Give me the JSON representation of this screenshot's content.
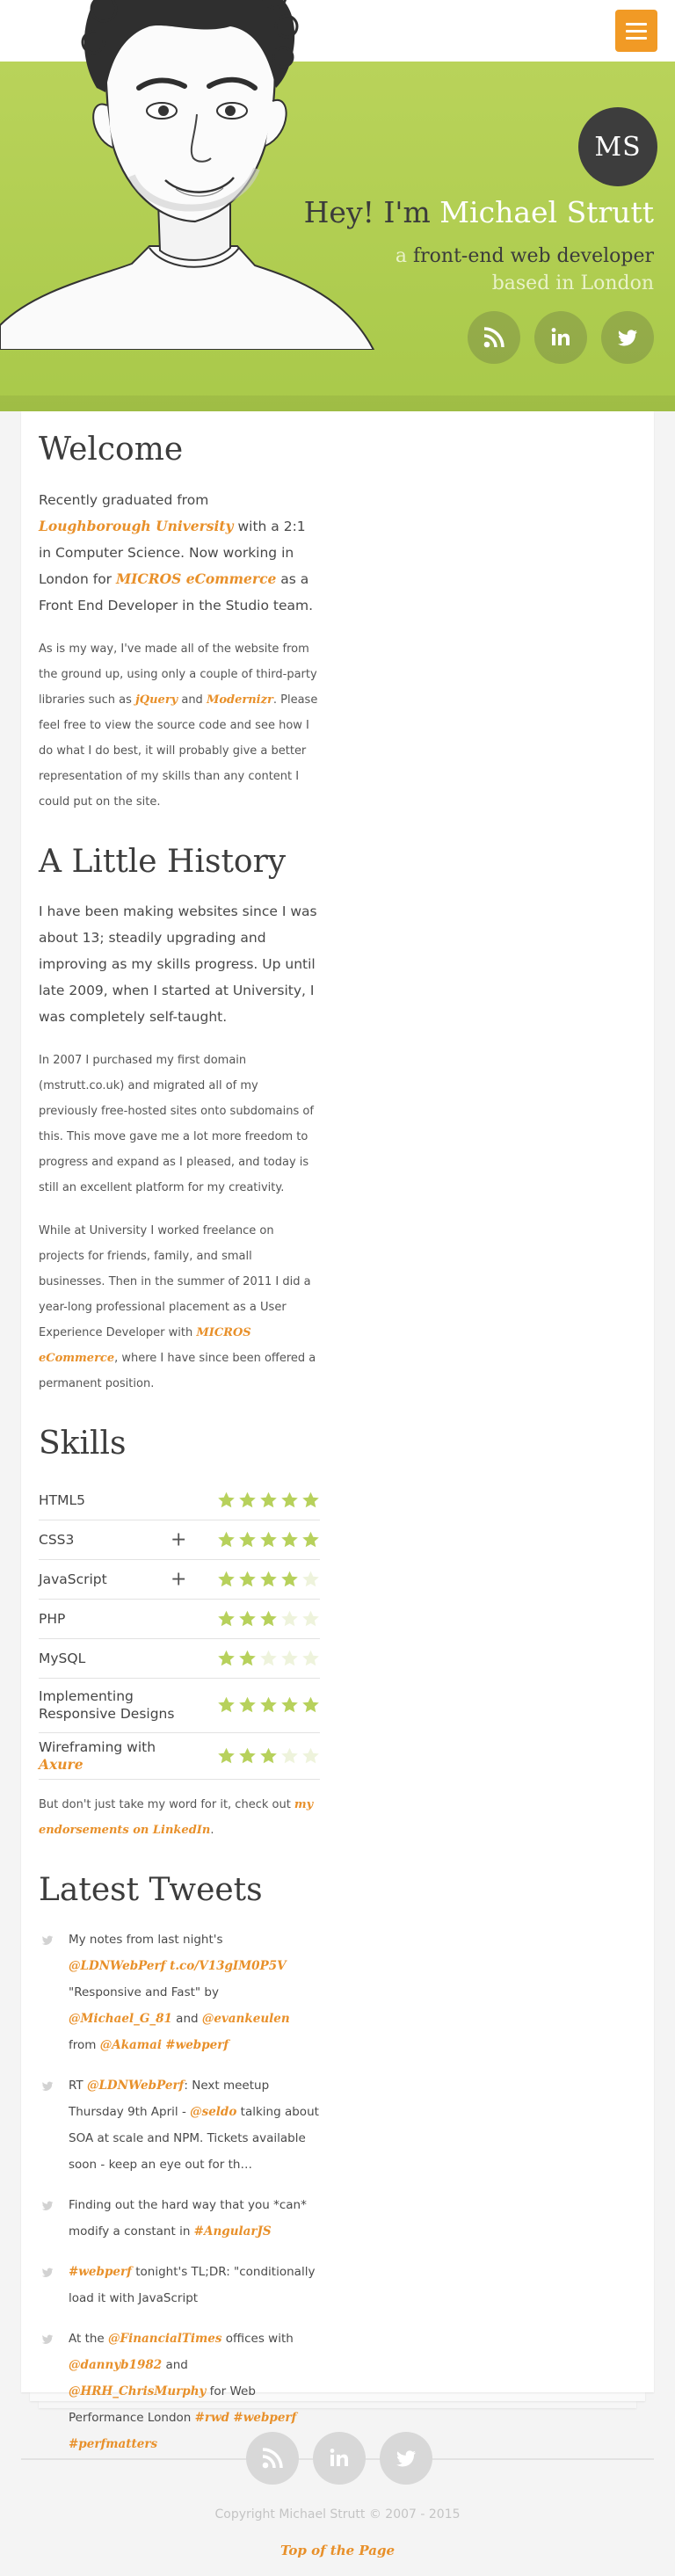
{
  "colors": {
    "accent": "#e8902a",
    "hero_green": "#b5cf54",
    "dark": "#3c3c3c",
    "star_on": "#b7d15c",
    "star_off": "#eef3dc"
  },
  "header": {
    "menu_icon": "hamburger-icon"
  },
  "hero": {
    "monogram": "MS",
    "greeting": "Hey! I'm ",
    "name": "Michael Strutt",
    "sub_a": "a ",
    "sub_role": "front-end web developer",
    "sub_b": " based in London",
    "social": [
      {
        "name": "rss",
        "icon": "rss-icon"
      },
      {
        "name": "linkedin",
        "icon": "linkedin-icon"
      },
      {
        "name": "twitter",
        "icon": "twitter-icon"
      }
    ]
  },
  "welcome": {
    "heading": "Welcome",
    "p1_a": "Recently graduated from ",
    "p1_link1": "Loughborough University",
    "p1_b": " with a 2:1 in Computer Science. Now working in London for ",
    "p1_link2": "MICROS eCommerce",
    "p1_c": " as a Front End Developer in the Studio team.",
    "p2_a": "As is my way, I've made all of the website from the ground up, using only a couple of third-party libraries such as ",
    "p2_link1": "jQuery",
    "p2_b": " and ",
    "p2_link2": "Modernizr",
    "p2_c": ". Please feel free to view the source code and see how I do what I do best, it will probably give a better representation of my skills than any content I could put on the site."
  },
  "history": {
    "heading": "A Little History",
    "p1": "I have been making websites since I was about 13; steadily upgrading and improving as my skills progress. Up until late 2009, when I started at University, I was completely self-taught.",
    "p2": "In 2007 I purchased my first domain (mstrutt.co.uk) and migrated all of my previously free-hosted sites onto subdomains of this. This move gave me a lot more freedom to progress and expand as I pleased, and today is still an excellent platform for my creativity.",
    "p3_a": "While at University I worked freelance on projects for friends, family, and small businesses. Then in the summer of 2011 I did a year-long professional placement as a User Experience Developer with ",
    "p3_link": "MICROS eCommerce",
    "p3_b": ", where I have since been offered a permanent position."
  },
  "skills": {
    "heading": "Skills",
    "items": [
      {
        "name": "HTML5",
        "rating": 5,
        "expandable": false
      },
      {
        "name": "CSS3",
        "rating": 5,
        "expandable": true
      },
      {
        "name": "JavaScript",
        "rating": 4,
        "expandable": true
      },
      {
        "name": "PHP",
        "rating": 3,
        "expandable": false
      },
      {
        "name": "MySQL",
        "rating": 2,
        "expandable": false
      },
      {
        "name": "Implementing Responsive Designs",
        "rating": 5,
        "expandable": false
      },
      {
        "name": "Wireframing with ",
        "link": "Axure",
        "rating": 3,
        "expandable": false
      }
    ],
    "plus_glyph": "+",
    "endorse_a": "But don't just take my word for it, check out ",
    "endorse_link": "my endorsements on LinkedIn",
    "endorse_b": "."
  },
  "tweets": {
    "heading": "Latest Tweets",
    "items": [
      {
        "parts": [
          {
            "t": "My notes from last night's "
          },
          {
            "t": "@LDNWebPerf t.co/V13gIM0P5V",
            "link": true
          },
          {
            "t": " \"Responsive and Fast\" by "
          },
          {
            "t": "@Michael_G_81",
            "link": true
          },
          {
            "t": " and "
          },
          {
            "t": "@evankeulen",
            "link": true
          },
          {
            "t": " from "
          },
          {
            "t": "@Akamai",
            "link": true
          },
          {
            "t": " "
          },
          {
            "t": "#webperf",
            "link": true
          }
        ]
      },
      {
        "parts": [
          {
            "t": "RT "
          },
          {
            "t": "@LDNWebPerf",
            "link": true
          },
          {
            "t": ": Next meetup Thursday 9th April - "
          },
          {
            "t": "@seldo",
            "link": true
          },
          {
            "t": " talking about SOA at scale and NPM. Tickets available soon - keep an eye out for th…"
          }
        ]
      },
      {
        "parts": [
          {
            "t": "Finding out the hard way that you *can* modify a constant in "
          },
          {
            "t": "#AngularJS",
            "link": true
          }
        ]
      },
      {
        "parts": [
          {
            "t": "#webperf",
            "link": true
          },
          {
            "t": " tonight's TL;DR: \"conditionally load it with JavaScript"
          }
        ]
      },
      {
        "parts": [
          {
            "t": "At the "
          },
          {
            "t": "@FinancialTimes",
            "link": true
          },
          {
            "t": " offices with "
          },
          {
            "t": "@dannyb1982",
            "link": true
          },
          {
            "t": " and "
          },
          {
            "t": "@HRH_ChrisMurphy",
            "link": true
          },
          {
            "t": " for Web Performance London "
          },
          {
            "t": "#rwd",
            "link": true
          },
          {
            "t": " "
          },
          {
            "t": "#webperf",
            "link": true
          },
          {
            "t": " "
          },
          {
            "t": "#perfmatters",
            "link": true
          }
        ]
      }
    ]
  },
  "footer": {
    "copyright": "Copyright Michael Strutt © 2007 - 2015",
    "top_link": "Top of the Page"
  }
}
